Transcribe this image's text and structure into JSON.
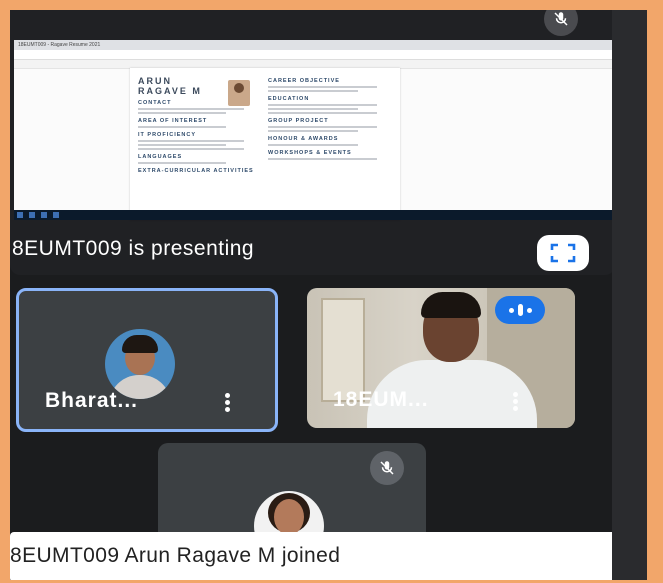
{
  "presentation": {
    "label": "8EUMT009 is presenting",
    "shared_screen": {
      "browser_tab": "18EUMT009 - Ragave Resume 2021",
      "document": {
        "name_line1": "ARUN",
        "name_line2": "RAGAVE M",
        "left_sections": [
          "CONTACT",
          "AREA OF INTEREST",
          "IT PROFICIENCY",
          "LANGUAGES",
          "EXTRA-CURRICULAR ACTIVITIES"
        ],
        "right_sections": [
          "CAREER OBJECTIVE",
          "EDUCATION",
          "GROUP PROJECT",
          "HONOUR & AWARDS",
          "WORKSHOPS & EVENTS"
        ]
      }
    }
  },
  "participants": [
    {
      "name": "Bharat...",
      "avatar": "profile-photo"
    },
    {
      "name": "18EUM...",
      "avatar": "live-camera"
    }
  ],
  "icons": {
    "mute": "mic-off-icon",
    "fullscreen": "fullscreen-icon",
    "more": "more-vert-icon",
    "speaking": "audio-level-icon"
  },
  "notification": {
    "text": "8EUMT009 Arun Ragave M joined"
  },
  "colors": {
    "accent": "#1a73e8",
    "tile_border": "#8ab4f8",
    "background": "#f2a66a"
  }
}
